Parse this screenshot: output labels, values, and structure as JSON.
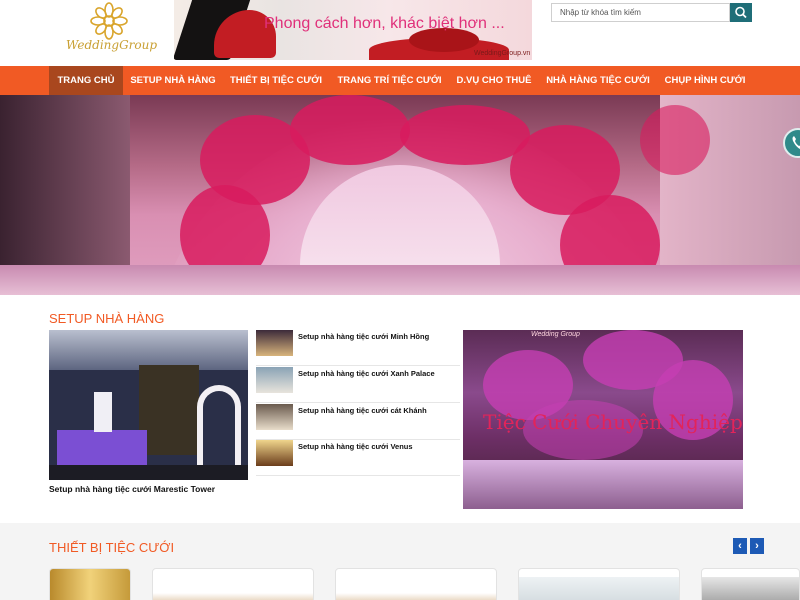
{
  "header": {
    "logo_text": "WeddingGroup",
    "banner_text": "Phong cách hơn, khác biệt hơn ...",
    "banner_mark": "WeddingGroup.vn",
    "search_placeholder": "Nhập từ khóa tìm kiếm"
  },
  "nav": {
    "items": [
      {
        "label": "TRANG CHỦ"
      },
      {
        "label": "SETUP NHÀ HÀNG"
      },
      {
        "label": "THIẾT BỊ TIỆC CƯỚI"
      },
      {
        "label": "TRANG TRÍ TIỆC CƯỚI"
      },
      {
        "label": "D.VỤ CHO THUÊ"
      },
      {
        "label": "NHÀ HÀNG TIỆC CƯỚI"
      },
      {
        "label": "CHỤP HÌNH CƯỚI"
      }
    ]
  },
  "setup": {
    "title": "SETUP NHÀ HÀNG",
    "main_caption": "Setup nhà hàng tiệc cưới Marestic Tower",
    "items": [
      {
        "label": "Setup nhà hàng tiệc cưới Minh Hồng"
      },
      {
        "label": "Setup nhà hàng tiệc cưới Xanh Palace"
      },
      {
        "label": "Setup nhà hàng tiệc cưới cát Khánh"
      },
      {
        "label": "Setup nhà hàng tiệc cưới Venus"
      }
    ],
    "promo_text": "Tiệc Cưới Chuyên Nghiệp",
    "promo_mark": "Wedding Group"
  },
  "equipment": {
    "title": "THIẾT BỊ TIỆC CƯỚI",
    "prev_label": "‹",
    "next_label": "›"
  },
  "colors": {
    "accent": "#f15a24",
    "nav_active": "#a9471e",
    "search_button": "#1f6e78",
    "arrow_button": "#1d5ab5"
  },
  "icons": {
    "search": "search-icon",
    "phone": "phone-icon",
    "logo": "flower-logo-icon"
  }
}
